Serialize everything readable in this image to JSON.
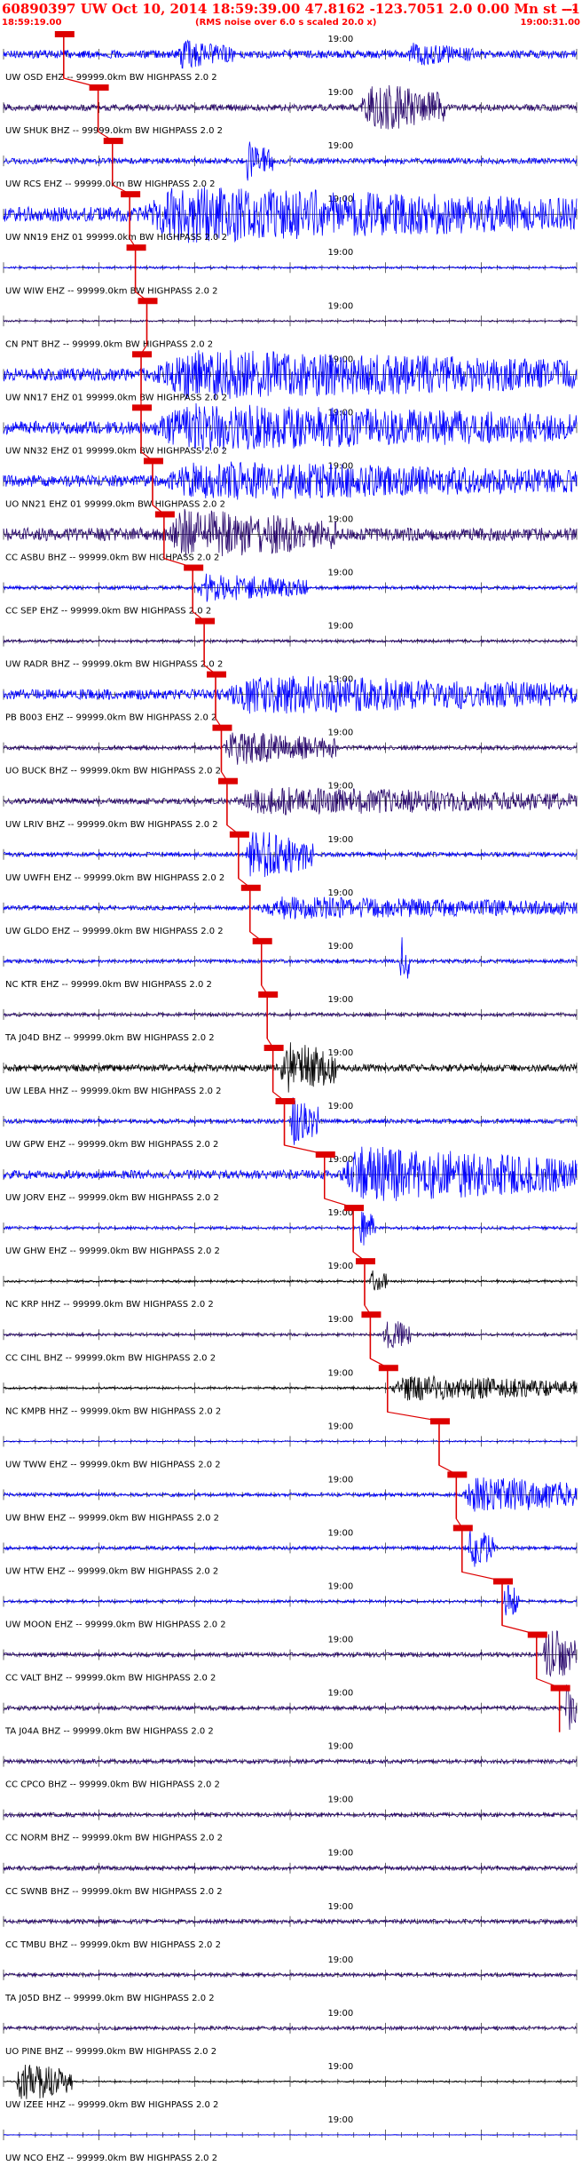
{
  "header": {
    "title": "60890397 UW Oct 10, 2014 18:59:39.00   47.8162 -123.7051  2.0 0.00 Mn st --- -- --",
    "title_right": "-1",
    "start_time": "18:59:19.00",
    "end_time": "19:00:31.00",
    "note": "(RMS noise over 6.0 s scaled 20.0 x)"
  },
  "colors": {
    "header_red": "#ff0000",
    "pick_red": "#dd0000",
    "blue": "#0000ff",
    "purple": "#2b0a6e",
    "black": "#000000"
  },
  "chart_data": {
    "type": "line",
    "title": "60890397 UW Oct 10, 2014 18:59:39.00   47.8162 -123.7051  2.0 0.00 Mn st --- -- --",
    "x_range": [
      "18:59:19.00",
      "19:00:31.00"
    ],
    "x_tick_label": "19:00",
    "traces": [
      {
        "label": "UW OSD EHZ -- 99999.0km BW  HIGHPASS  2.0  2",
        "color": "blue",
        "pick": 0.105,
        "amp": 0.55,
        "events": [
          [
            0.3,
            0.1,
            0.5
          ],
          [
            0.7,
            0.12,
            0.4
          ]
        ]
      },
      {
        "label": "UW SHUK BHZ -- 99999.0km BW  HIGHPASS  2.0  2",
        "color": "purple",
        "pick": 0.165,
        "amp": 0.45,
        "events": [
          [
            0.62,
            0.15,
            0.9
          ]
        ]
      },
      {
        "label": "UW RCS EHZ -- 99999.0km BW  HIGHPASS  2.0  2",
        "color": "blue",
        "pick": 0.19,
        "amp": 0.4,
        "events": [
          [
            0.42,
            0.05,
            0.7
          ]
        ]
      },
      {
        "label": "UW NN19 EHZ 01 99999.0km BW  HIGHPASS  2.0  2",
        "color": "blue",
        "pick": 0.22,
        "amp": 1.0,
        "events": [
          [
            0.22,
            0.78,
            1.0
          ]
        ]
      },
      {
        "label": "UW WIW EHZ -- 99999.0km BW  HIGHPASS  2.0  2",
        "color": "blue",
        "pick": 0.23,
        "amp": 0.15,
        "events": []
      },
      {
        "label": "CN PNT BHZ -- 99999.0km BW  HIGHPASS  2.0  2",
        "color": "purple",
        "pick": 0.25,
        "amp": 0.12,
        "events": []
      },
      {
        "label": "UW NN17 EHZ 01 99999.0km BW  HIGHPASS  2.0  2",
        "color": "blue",
        "pick": 0.24,
        "amp": 0.9,
        "events": [
          [
            0.24,
            0.76,
            0.9
          ]
        ]
      },
      {
        "label": "UW NN32 EHZ 01 99999.0km BW  HIGHPASS  2.0  2",
        "color": "blue",
        "pick": 0.24,
        "amp": 0.9,
        "events": [
          [
            0.24,
            0.76,
            0.85
          ]
        ]
      },
      {
        "label": "UO NN21 EHZ 01 99999.0km BW  HIGHPASS  2.0  2",
        "color": "blue",
        "pick": 0.26,
        "amp": 0.8,
        "events": [
          [
            0.26,
            0.74,
            0.7
          ]
        ]
      },
      {
        "label": "CC ASBU BHZ -- 99999.0km BW  HIGHPASS  2.0  2",
        "color": "purple",
        "pick": 0.28,
        "amp": 0.9,
        "events": [
          [
            0.28,
            0.3,
            0.9
          ]
        ]
      },
      {
        "label": "CC SEP EHZ -- 99999.0km BW  HIGHPASS  2.0  2",
        "color": "blue",
        "pick": 0.33,
        "amp": 0.25,
        "events": [
          [
            0.33,
            0.2,
            0.5
          ]
        ]
      },
      {
        "label": "UW RADR BHZ -- 99999.0km BW  HIGHPASS  2.0  2",
        "color": "purple",
        "pick": 0.35,
        "amp": 0.2,
        "events": []
      },
      {
        "label": "PB B003 EHZ -- 99999.0km BW  HIGHPASS  2.0  2",
        "color": "blue",
        "pick": 0.37,
        "amp": 0.7,
        "events": [
          [
            0.37,
            0.63,
            0.7
          ]
        ]
      },
      {
        "label": "UO BUCK BHZ -- 99999.0km BW  HIGHPASS  2.0  2",
        "color": "purple",
        "pick": 0.38,
        "amp": 0.3,
        "events": [
          [
            0.38,
            0.2,
            0.6
          ]
        ]
      },
      {
        "label": "UW LRIV BHZ -- 99999.0km BW  HIGHPASS  2.0  2",
        "color": "purple",
        "pick": 0.39,
        "amp": 0.4,
        "events": [
          [
            0.39,
            0.61,
            0.5
          ]
        ]
      },
      {
        "label": "UW UWFH EHZ -- 99999.0km BW  HIGHPASS  2.0  2",
        "color": "blue",
        "pick": 0.41,
        "amp": 0.3,
        "events": [
          [
            0.42,
            0.12,
            0.9
          ]
        ]
      },
      {
        "label": "UW GLDO EHZ -- 99999.0km BW  HIGHPASS  2.0  2",
        "color": "blue",
        "pick": 0.43,
        "amp": 0.3,
        "events": [
          [
            0.43,
            0.57,
            0.4
          ]
        ]
      },
      {
        "label": "NC KTR EHZ -- 99999.0km BW  HIGHPASS  2.0  2",
        "color": "blue",
        "pick": 0.45,
        "amp": 0.25,
        "events": [
          [
            0.69,
            0.02,
            0.9
          ]
        ]
      },
      {
        "label": "TA J04D BHZ -- 99999.0km BW  HIGHPASS  2.0  2",
        "color": "purple",
        "pick": 0.46,
        "amp": 0.25,
        "events": []
      },
      {
        "label": "UW LEBA HHZ -- 99999.0km BW  HIGHPASS  2.0  2",
        "color": "black",
        "pick": 0.47,
        "amp": 0.5,
        "events": [
          [
            0.48,
            0.1,
            1.0
          ]
        ]
      },
      {
        "label": "UW GPW EHZ -- 99999.0km BW  HIGHPASS  2.0  2",
        "color": "blue",
        "pick": 0.49,
        "amp": 0.3,
        "events": [
          [
            0.5,
            0.05,
            0.9
          ]
        ]
      },
      {
        "label": "UW JORV EHZ -- 99999.0km BW  HIGHPASS  2.0  2",
        "color": "blue",
        "pick": 0.56,
        "amp": 0.6,
        "events": [
          [
            0.58,
            0.42,
            1.0
          ]
        ]
      },
      {
        "label": "UW GHW EHZ -- 99999.0km BW  HIGHPASS  2.0  2",
        "color": "blue",
        "pick": 0.61,
        "amp": 0.2,
        "events": [
          [
            0.62,
            0.03,
            0.7
          ]
        ]
      },
      {
        "label": "NC KRP HHZ -- 99999.0km BW  HIGHPASS  2.0  2",
        "color": "black",
        "pick": 0.63,
        "amp": 0.15,
        "events": [
          [
            0.64,
            0.03,
            0.5
          ]
        ]
      },
      {
        "label": "CC CIHL BHZ -- 99999.0km BW  HIGHPASS  2.0  2",
        "color": "purple",
        "pick": 0.64,
        "amp": 0.2,
        "events": [
          [
            0.66,
            0.05,
            0.6
          ]
        ]
      },
      {
        "label": "NC KMPB HHZ -- 99999.0km BW  HIGHPASS  2.0  2",
        "color": "black",
        "pick": 0.67,
        "amp": 0.15,
        "events": [
          [
            0.67,
            0.33,
            0.45
          ]
        ]
      },
      {
        "label": "UW TWW EHZ -- 99999.0km BW  HIGHPASS  2.0  2",
        "color": "blue",
        "pick": 0.76,
        "amp": 0.1,
        "events": []
      },
      {
        "label": "UW BHW EHZ -- 99999.0km BW  HIGHPASS  2.0  2",
        "color": "blue",
        "pick": 0.79,
        "amp": 0.25,
        "events": [
          [
            0.8,
            0.2,
            0.7
          ]
        ]
      },
      {
        "label": "UW HTW EHZ -- 99999.0km BW  HIGHPASS  2.0  2",
        "color": "blue",
        "pick": 0.8,
        "amp": 0.25,
        "events": [
          [
            0.81,
            0.05,
            0.8
          ]
        ]
      },
      {
        "label": "UW MOON EHZ -- 99999.0km BW  HIGHPASS  2.0  2",
        "color": "blue",
        "pick": 0.87,
        "amp": 0.2,
        "events": [
          [
            0.87,
            0.03,
            0.7
          ]
        ]
      },
      {
        "label": "CC VALT BHZ -- 99999.0km BW  HIGHPASS  2.0  2",
        "color": "purple",
        "pick": 0.93,
        "amp": 0.3,
        "events": [
          [
            0.94,
            0.06,
            1.0
          ]
        ]
      },
      {
        "label": "TA J04A BHZ -- 99999.0km BW  HIGHPASS  2.0  2",
        "color": "purple",
        "pick": 0.97,
        "amp": 0.3,
        "events": [
          [
            0.98,
            0.02,
            0.9
          ]
        ]
      },
      {
        "label": "CC CPCO BHZ -- 99999.0km BW  HIGHPASS  2.0  2",
        "color": "purple",
        "pick": null,
        "amp": 0.3,
        "events": []
      },
      {
        "label": "CC NORM BHZ -- 99999.0km BW  HIGHPASS  2.0  2",
        "color": "purple",
        "pick": null,
        "amp": 0.3,
        "events": []
      },
      {
        "label": "CC SWNB BHZ -- 99999.0km BW  HIGHPASS  2.0  2",
        "color": "purple",
        "pick": null,
        "amp": 0.3,
        "events": []
      },
      {
        "label": "CC TMBU BHZ -- 99999.0km BW  HIGHPASS  2.0  2",
        "color": "purple",
        "pick": null,
        "amp": 0.3,
        "events": []
      },
      {
        "label": "TA J05D BHZ -- 99999.0km BW  HIGHPASS  2.0  2",
        "color": "purple",
        "pick": null,
        "amp": 0.25,
        "events": []
      },
      {
        "label": "UO PINE BHZ -- 99999.0km BW  HIGHPASS  2.0  2",
        "color": "purple",
        "pick": null,
        "amp": 0.25,
        "events": []
      },
      {
        "label": "UW IZEE HHZ -- 99999.0km BW  HIGHPASS  2.0  2",
        "color": "black",
        "pick": null,
        "amp": 0.1,
        "events": [
          [
            0.02,
            0.1,
            0.7
          ]
        ]
      },
      {
        "label": "UW NCO EHZ -- 99999.0km BW  HIGHPASS  2.0  2",
        "color": "blue",
        "pick": null,
        "amp": 0.05,
        "events": []
      }
    ]
  }
}
